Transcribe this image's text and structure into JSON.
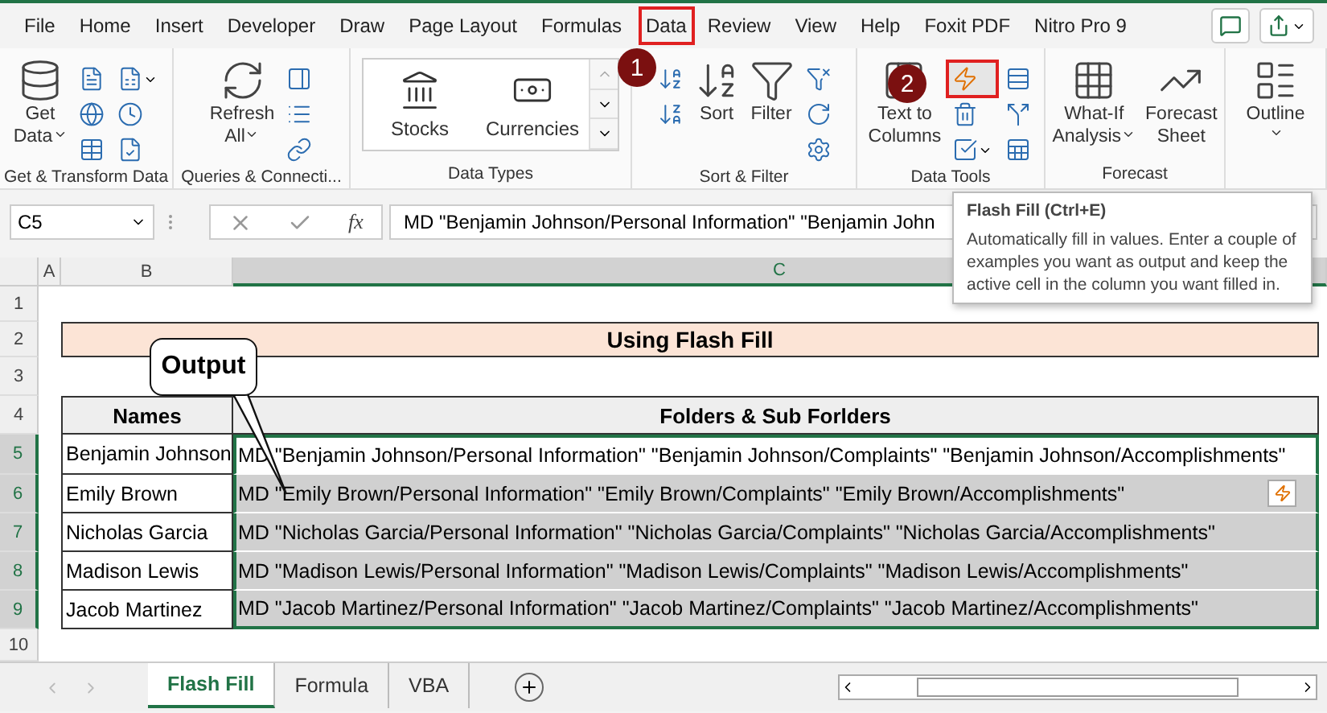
{
  "menu_tabs": [
    {
      "label": "File",
      "selected": false
    },
    {
      "label": "Home",
      "selected": false
    },
    {
      "label": "Insert",
      "selected": false
    },
    {
      "label": "Developer",
      "selected": false
    },
    {
      "label": "Draw",
      "selected": false
    },
    {
      "label": "Page Layout",
      "selected": false
    },
    {
      "label": "Formulas",
      "selected": false
    },
    {
      "label": "Data",
      "selected": true
    },
    {
      "label": "Review",
      "selected": false
    },
    {
      "label": "View",
      "selected": false
    },
    {
      "label": "Help",
      "selected": false
    },
    {
      "label": "Foxit PDF",
      "selected": false
    },
    {
      "label": "Nitro Pro 9",
      "selected": false
    }
  ],
  "ribbon_groups": [
    {
      "label": "Get & Transform Data",
      "items": [
        {
          "kind": "large",
          "label": "Get",
          "label_2": "Data",
          "dropdown": true
        },
        {
          "kind": "small_stack",
          "buttons": [
            {
              "selected": false,
              "dropdown": false
            },
            {
              "selected": false,
              "dropdown": false
            },
            {
              "selected": false,
              "dropdown": false
            }
          ]
        },
        {
          "kind": "small_stack",
          "buttons": [
            {
              "selected": false,
              "dropdown": true
            },
            {
              "selected": false,
              "dropdown": false
            },
            {
              "selected": false,
              "dropdown": false
            }
          ]
        }
      ]
    },
    {
      "label": "Queries & Connecti...",
      "items": [
        {
          "kind": "large",
          "label": "Refresh",
          "label_2": "All",
          "dropdown": true
        },
        {
          "kind": "small_stack",
          "buttons": [
            {
              "selected": false,
              "dropdown": false
            },
            {
              "selected": false,
              "dropdown": false
            },
            {
              "selected": false,
              "dropdown": false
            }
          ]
        }
      ]
    },
    {
      "label": "Data Types",
      "items": [
        {
          "kind": "gallery",
          "cards": [
            "Stocks",
            "Currencies"
          ]
        }
      ]
    },
    {
      "label": "Sort & Filter",
      "items": [
        {
          "kind": "small_stack",
          "buttons": [
            {
              "selected": false,
              "dropdown": false
            },
            {
              "selected": false,
              "dropdown": false
            }
          ]
        },
        {
          "kind": "large",
          "label": "Sort",
          "dropdown": false
        },
        {
          "kind": "large",
          "label": "Filter",
          "dropdown": false
        },
        {
          "kind": "small_stack",
          "buttons": [
            {
              "selected": false,
              "dropdown": false
            },
            {
              "selected": false,
              "dropdown": false
            },
            {
              "selected": false,
              "dropdown": false
            }
          ]
        }
      ]
    },
    {
      "label": "Data Tools",
      "items": [
        {
          "kind": "large",
          "label": "Text to",
          "label_2": "Columns",
          "dropdown": false
        },
        {
          "kind": "small_stack",
          "buttons": [
            {
              "selected": true,
              "dropdown": false
            },
            {
              "selected": false,
              "dropdown": false
            },
            {
              "selected": false,
              "dropdown": true
            }
          ]
        },
        {
          "kind": "small_stack",
          "buttons": [
            {
              "selected": false,
              "dropdown": false
            },
            {
              "selected": false,
              "dropdown": false
            },
            {
              "selected": false,
              "dropdown": false
            }
          ]
        }
      ]
    },
    {
      "label": "Forecast",
      "items": [
        {
          "kind": "large",
          "label": "What-If",
          "label_2": "Analysis",
          "dropdown": true
        },
        {
          "kind": "large",
          "label": "Forecast",
          "label_2": "Sheet",
          "dropdown": false
        }
      ]
    },
    {
      "items": [
        {
          "kind": "large",
          "label": "Outline",
          "dropdown": true
        }
      ]
    }
  ],
  "name_box": "C5",
  "function_label": "fx",
  "formula": "MD \"Benjamin Johnson/Personal Information\" \"Benjamin John",
  "tooltip": {
    "title": "Flash Fill (Ctrl+E)",
    "body": "Automatically fill in values. Enter a couple of examples you want as output and keep the active cell in the column you want filled in."
  },
  "columns": [
    {
      "label": "A",
      "selected": false
    },
    {
      "label": "B",
      "selected": false
    },
    {
      "label": "C",
      "selected": true
    }
  ],
  "row_numbers": [
    {
      "label": "1",
      "selected": false
    },
    {
      "label": "2",
      "selected": false
    },
    {
      "label": "3",
      "selected": false
    },
    {
      "label": "4",
      "selected": false
    },
    {
      "label": "5",
      "selected": true
    },
    {
      "label": "6",
      "selected": true
    },
    {
      "label": "7",
      "selected": true
    },
    {
      "label": "8",
      "selected": true
    },
    {
      "label": "9",
      "selected": true
    },
    {
      "label": "10",
      "selected": false
    }
  ],
  "title": "Using Flash Fill",
  "table": {
    "columns": [
      "Names",
      "Folders & Sub Forlders"
    ],
    "rows": [
      {
        "name": "Benjamin Johnson",
        "command": "MD \"Benjamin Johnson/Personal Information\" \"Benjamin Johnson/Complaints\" \"Benjamin Johnson/Accomplishments\"",
        "active": true,
        "options_icon": false
      },
      {
        "name": "Emily Brown",
        "command": "MD \"Emily Brown/Personal Information\" \"Emily Brown/Complaints\" \"Emily Brown/Accomplishments\"",
        "active": false,
        "options_icon": true
      },
      {
        "name": "Nicholas Garcia",
        "command": "MD \"Nicholas Garcia/Personal Information\" \"Nicholas Garcia/Complaints\" \"Nicholas Garcia/Accomplishments\"",
        "active": false,
        "options_icon": false
      },
      {
        "name": "Madison Lewis",
        "command": "MD \"Madison Lewis/Personal Information\" \"Madison Lewis/Complaints\" \"Madison Lewis/Accomplishments\"",
        "active": false,
        "options_icon": false
      },
      {
        "name": "Jacob Martinez",
        "command": "MD \"Jacob Martinez/Personal Information\" \"Jacob Martinez/Complaints\" \"Jacob Martinez/Accomplishments\"",
        "active": false,
        "options_icon": false
      }
    ]
  },
  "callout": "Output",
  "annotations": [
    "1",
    "2"
  ],
  "sheet_tabs": [
    {
      "label": "Flash Fill",
      "selected": true
    },
    {
      "label": "Formula",
      "selected": false
    },
    {
      "label": "VBA",
      "selected": false
    }
  ]
}
